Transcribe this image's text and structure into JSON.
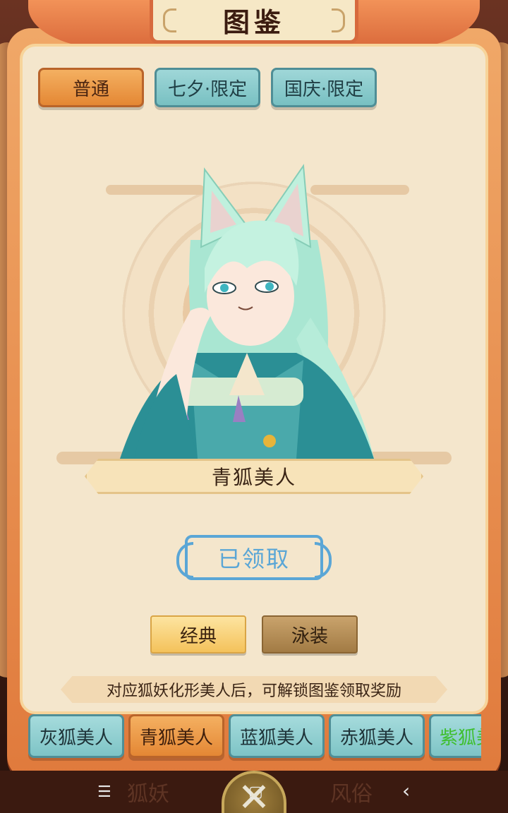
{
  "title": "图鉴",
  "category_tabs": [
    {
      "label": "普通",
      "active": true
    },
    {
      "label": "七夕·限定",
      "active": false
    },
    {
      "label": "国庆·限定",
      "active": false
    }
  ],
  "character": {
    "name": "青狐美人"
  },
  "claim_status": "已领取",
  "style_buttons": [
    {
      "label": "经典",
      "active": true
    },
    {
      "label": "泳装",
      "active": false
    }
  ],
  "hint": "对应狐妖化形美人后，可解锁图鉴领取奖励",
  "fox_tabs": [
    {
      "label": "灰狐美人",
      "active": false
    },
    {
      "label": "青狐美人",
      "active": true
    },
    {
      "label": "蓝狐美人",
      "active": false
    },
    {
      "label": "赤狐美人",
      "active": false
    },
    {
      "label": "紫狐美人",
      "active": false
    }
  ],
  "background_text": {
    "left": "狐妖",
    "right": "风俗"
  },
  "system_nav": {
    "menu": "☰",
    "home": "▢",
    "back": "‹"
  },
  "colors": {
    "active_tab": "#e48734",
    "inactive_tab": "#78c0c2",
    "claimed": "#5aa6d6",
    "purple_fox_text": "#3fbf2f"
  }
}
